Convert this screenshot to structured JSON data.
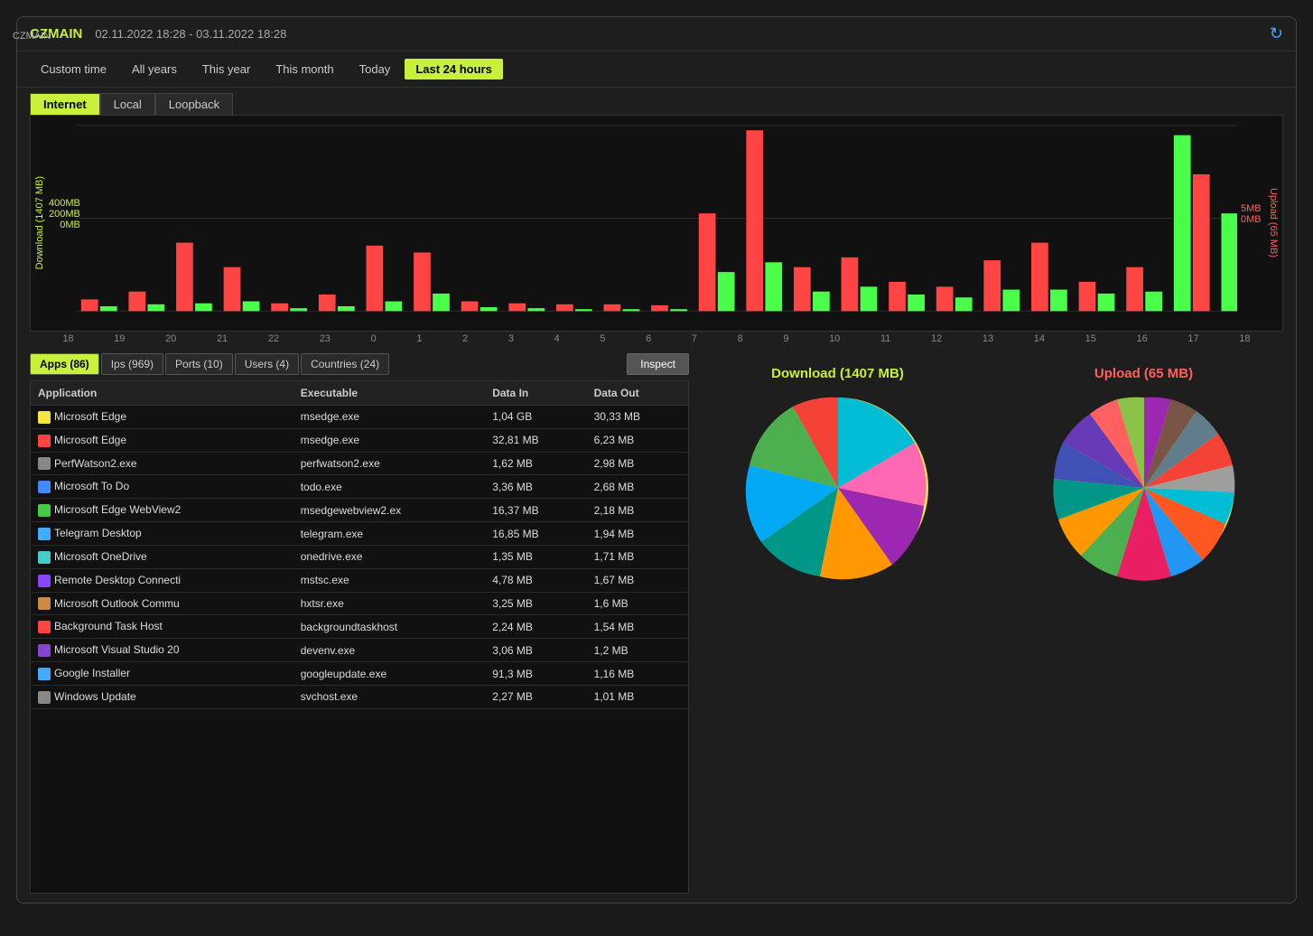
{
  "titleBar": {
    "appName": "CZMAIN",
    "dateRange": "02.11.2022 18:28 - 03.11.2022 18:28",
    "host": "CZMAIN"
  },
  "timeTabs": [
    {
      "label": "Custom time",
      "active": false
    },
    {
      "label": "All years",
      "active": false
    },
    {
      "label": "This year",
      "active": false
    },
    {
      "label": "This month",
      "active": false
    },
    {
      "label": "Today",
      "active": false
    },
    {
      "label": "Last 24 hours",
      "active": true
    }
  ],
  "networkTabs": [
    {
      "label": "Internet",
      "active": true
    },
    {
      "label": "Local",
      "active": false
    },
    {
      "label": "Loopback",
      "active": false
    }
  ],
  "chart": {
    "yAxisLeft": [
      "400MB",
      "200MB",
      "0MB"
    ],
    "yAxisLeftLabel": "Download (1407 MB)",
    "yAxisRight": [
      "5MB",
      "0MB"
    ],
    "yAxisRightLabel": "Upload (65 MB)",
    "xLabels": [
      "18",
      "19",
      "20",
      "21",
      "22",
      "23",
      "0",
      "1",
      "2",
      "3",
      "4",
      "5",
      "6",
      "7",
      "8",
      "9",
      "10",
      "11",
      "12",
      "13",
      "14",
      "15",
      "16",
      "17",
      "18"
    ]
  },
  "dataTabs": [
    {
      "label": "Apps (86)",
      "active": true
    },
    {
      "label": "Ips (969)",
      "active": false
    },
    {
      "label": "Ports (10)",
      "active": false
    },
    {
      "label": "Users (4)",
      "active": false
    },
    {
      "label": "Countries (24)",
      "active": false
    }
  ],
  "inspectButton": "Inspect",
  "tableHeaders": [
    "Application",
    "Executable",
    "Data In",
    "Data Out"
  ],
  "tableRows": [
    {
      "color": "#f5e642",
      "icon": "edge",
      "name": "Microsoft Edge",
      "exe": "msedge.exe",
      "dataIn": "1,04 GB",
      "dataOut": "30,33 MB"
    },
    {
      "color": "#ff4444",
      "icon": "edge",
      "name": "Microsoft Edge",
      "exe": "msedge.exe",
      "dataIn": "32,81 MB",
      "dataOut": "6,23 MB"
    },
    {
      "color": "#888",
      "icon": "perf",
      "name": "PerfWatson2.exe",
      "exe": "perfwatson2.exe",
      "dataIn": "1,62 MB",
      "dataOut": "2,98 MB"
    },
    {
      "color": "#4488ff",
      "icon": "todo",
      "name": "Microsoft To Do",
      "exe": "todo.exe",
      "dataIn": "3,36 MB",
      "dataOut": "2,68 MB"
    },
    {
      "color": "#44cc44",
      "icon": "edge",
      "name": "Microsoft Edge WebView2",
      "exe": "msedgewebview2.ex",
      "dataIn": "16,37 MB",
      "dataOut": "2,18 MB"
    },
    {
      "color": "#44aaff",
      "icon": "telegram",
      "name": "Telegram Desktop",
      "exe": "telegram.exe",
      "dataIn": "16,85 MB",
      "dataOut": "1,94 MB"
    },
    {
      "color": "#44cccc",
      "icon": "onedrive",
      "name": "Microsoft OneDrive",
      "exe": "onedrive.exe",
      "dataIn": "1,35 MB",
      "dataOut": "1,71 MB"
    },
    {
      "color": "#8844ff",
      "icon": "rdp",
      "name": "Remote Desktop Connecti",
      "exe": "mstsc.exe",
      "dataIn": "4,78 MB",
      "dataOut": "1,67 MB"
    },
    {
      "color": "#cc8844",
      "icon": "outlook",
      "name": "Microsoft Outlook Commu",
      "exe": "hxtsr.exe",
      "dataIn": "3,25 MB",
      "dataOut": "1,6 MB"
    },
    {
      "color": "#ff4444",
      "icon": "bg",
      "name": "Background Task Host",
      "exe": "backgroundtaskhost",
      "dataIn": "2,24 MB",
      "dataOut": "1,54 MB"
    },
    {
      "color": "#8844cc",
      "icon": "vs",
      "name": "Microsoft Visual Studio 20",
      "exe": "devenv.exe",
      "dataIn": "3,06 MB",
      "dataOut": "1,2 MB"
    },
    {
      "color": "#44aaff",
      "icon": "google",
      "name": "Google Installer",
      "exe": "googleupdate.exe",
      "dataIn": "91,3 MB",
      "dataOut": "1,16 MB"
    },
    {
      "color": "#888",
      "icon": "win",
      "name": "Windows Update",
      "exe": "svchost.exe",
      "dataIn": "2,27 MB",
      "dataOut": "1,01 MB"
    }
  ],
  "pieCharts": {
    "download": {
      "label": "Download (1407 MB)",
      "total": 1407
    },
    "upload": {
      "label": "Upload (65 MB)",
      "total": 65
    }
  }
}
